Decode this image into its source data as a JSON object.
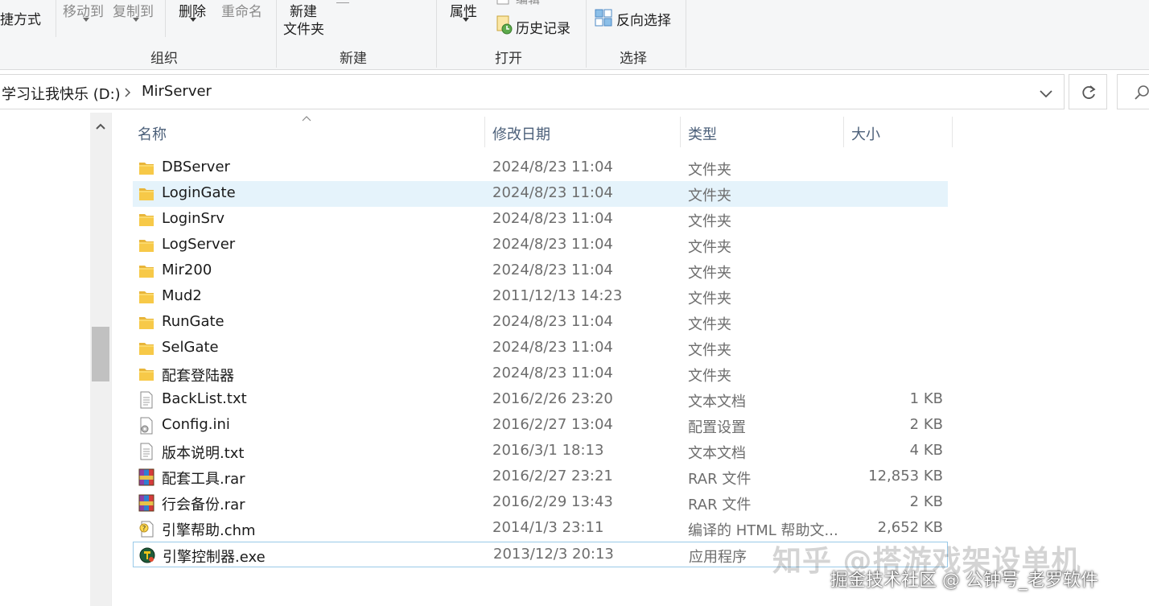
{
  "ribbon": {
    "organize": {
      "shortcut_label": "捷方式",
      "move_to_label": "移动到",
      "copy_to_label": "复制到",
      "delete_label": "删除",
      "rename_label": "重命名",
      "group_label": "组织"
    },
    "new": {
      "new_folder_line1": "新建",
      "new_folder_line2": "文件夹",
      "group_label": "新建"
    },
    "open": {
      "properties_label": "属性",
      "edit_label": "编辑",
      "history_label": "历史记录",
      "group_label": "打开"
    },
    "select": {
      "invert_label": "反向选择",
      "group_label": "选择"
    }
  },
  "address": {
    "crumbs": [
      "学习让我快乐 (D:)",
      "MirServer"
    ]
  },
  "columns": {
    "name": "名称",
    "date": "修改日期",
    "type": "类型",
    "size": "大小"
  },
  "files": [
    {
      "name": "DBServer",
      "date": "2024/8/23 11:04",
      "type": "文件夹",
      "size": "",
      "icon": "folder-icon"
    },
    {
      "name": "LoginGate",
      "date": "2024/8/23 11:04",
      "type": "文件夹",
      "size": "",
      "icon": "folder-icon"
    },
    {
      "name": "LoginSrv",
      "date": "2024/8/23 11:04",
      "type": "文件夹",
      "size": "",
      "icon": "folder-icon"
    },
    {
      "name": "LogServer",
      "date": "2024/8/23 11:04",
      "type": "文件夹",
      "size": "",
      "icon": "folder-icon"
    },
    {
      "name": "Mir200",
      "date": "2024/8/23 11:04",
      "type": "文件夹",
      "size": "",
      "icon": "folder-icon"
    },
    {
      "name": "Mud2",
      "date": "2011/12/13 14:23",
      "type": "文件夹",
      "size": "",
      "icon": "folder-icon"
    },
    {
      "name": "RunGate",
      "date": "2024/8/23 11:04",
      "type": "文件夹",
      "size": "",
      "icon": "folder-icon"
    },
    {
      "name": "SelGate",
      "date": "2024/8/23 11:04",
      "type": "文件夹",
      "size": "",
      "icon": "folder-icon"
    },
    {
      "name": "配套登陆器",
      "date": "2024/8/23 11:04",
      "type": "文件夹",
      "size": "",
      "icon": "folder-icon"
    },
    {
      "name": "BackList.txt",
      "date": "2016/2/26 23:20",
      "type": "文本文档",
      "size": "1 KB",
      "icon": "text-file-icon"
    },
    {
      "name": "Config.ini",
      "date": "2016/2/27 13:04",
      "type": "配置设置",
      "size": "2 KB",
      "icon": "config-file-icon"
    },
    {
      "name": "版本说明.txt",
      "date": "2016/3/1 18:13",
      "type": "文本文档",
      "size": "4 KB",
      "icon": "text-file-icon"
    },
    {
      "name": "配套工具.rar",
      "date": "2016/2/27 23:21",
      "type": "RAR 文件",
      "size": "12,853 KB",
      "icon": "rar-archive-icon"
    },
    {
      "name": "行会备份.rar",
      "date": "2016/2/29 13:43",
      "type": "RAR 文件",
      "size": "2 KB",
      "icon": "rar-archive-icon"
    },
    {
      "name": "引擎帮助.chm",
      "date": "2014/1/3 23:11",
      "type": "编译的 HTML 帮助文...",
      "size": "2,652 KB",
      "icon": "chm-help-icon"
    },
    {
      "name": "引擎控制器.exe",
      "date": "2013/12/3 20:13",
      "type": "应用程序",
      "size": "",
      "icon": "exe-app-icon"
    }
  ],
  "state": {
    "hovered_row": "LoginGate",
    "focused_row": "引擎控制器.exe"
  },
  "watermark": {
    "line1": "知乎 @搭游戏架设单机",
    "line2": "掘金技术社区 @ 公钟号_老罗软件"
  },
  "colors": {
    "ribbon_bg": "#f5f6f7",
    "hover_row": "#e5f3fb",
    "header_text": "#4c607a",
    "folder_yellow": "#f7c948"
  }
}
